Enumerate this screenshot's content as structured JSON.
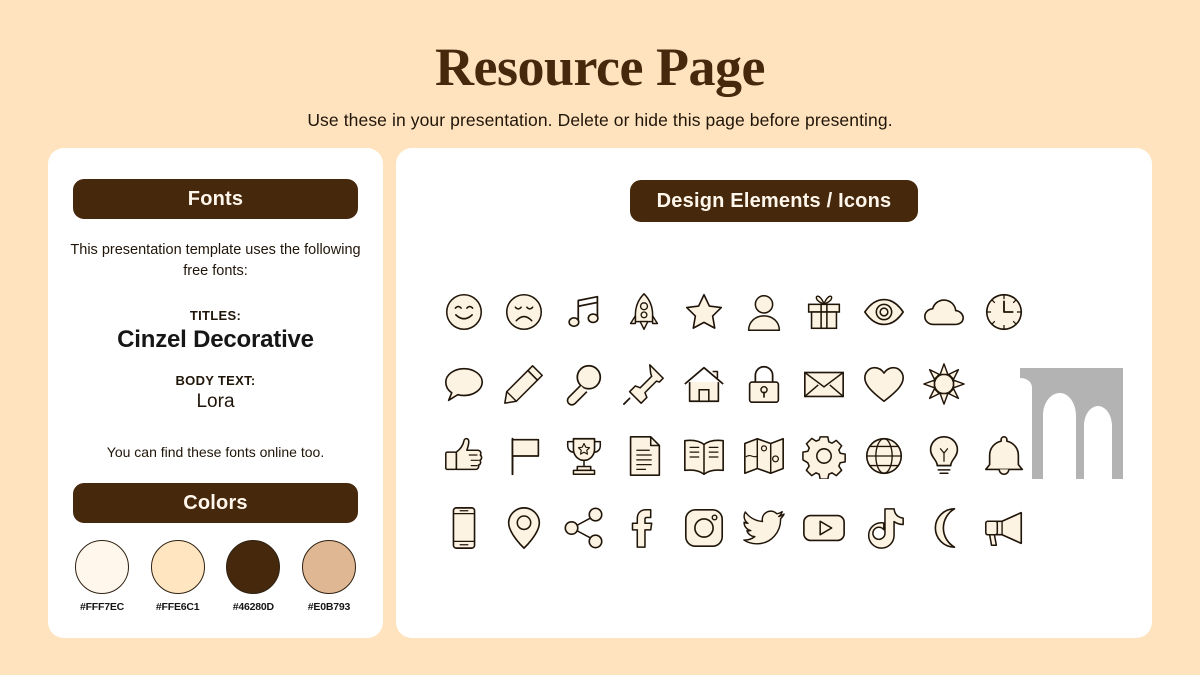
{
  "header": {
    "title": "Resource Page",
    "subtitle": "Use these in your presentation. Delete or hide this page before presenting."
  },
  "theme": {
    "background": "#FFE3BE",
    "panel": "#FFFFFF",
    "dark_brown": "#46280D",
    "cream": "#FFF7EC",
    "icon_fill": "#FDF3E3",
    "icon_stroke": "#201509",
    "arch_gray": "#B3B3B3"
  },
  "fonts_panel": {
    "heading": "Fonts",
    "intro": "This presentation template uses the following free fonts:",
    "titles_label": "TITLES:",
    "titles_font": "Cinzel Decorative",
    "body_label": "BODY TEXT:",
    "body_font": "Lora",
    "note": "You can find these fonts online too."
  },
  "colors_panel": {
    "heading": "Colors",
    "swatches": [
      {
        "hex": "#FFF7EC",
        "label": "#FFF7EC"
      },
      {
        "hex": "#FFE6C1",
        "label": "#FFE6C1"
      },
      {
        "hex": "#46280D",
        "label": "#46280D"
      },
      {
        "hex": "#E0B793",
        "label": "#E0B793"
      }
    ]
  },
  "design_panel": {
    "heading": "Design Elements / Icons",
    "icons": [
      {
        "name": "smiley-face-icon",
        "row": 1,
        "col": 1
      },
      {
        "name": "sad-face-icon",
        "row": 1,
        "col": 2
      },
      {
        "name": "music-note-icon",
        "row": 1,
        "col": 3
      },
      {
        "name": "rocket-icon",
        "row": 1,
        "col": 4
      },
      {
        "name": "star-icon",
        "row": 1,
        "col": 5
      },
      {
        "name": "user-icon",
        "row": 1,
        "col": 6
      },
      {
        "name": "gift-icon",
        "row": 1,
        "col": 7
      },
      {
        "name": "eye-icon",
        "row": 1,
        "col": 8
      },
      {
        "name": "cloud-icon",
        "row": 1,
        "col": 9
      },
      {
        "name": "clock-icon",
        "row": 1,
        "col": 10
      },
      {
        "name": "speech-bubble-icon",
        "row": 2,
        "col": 1
      },
      {
        "name": "pencil-icon",
        "row": 2,
        "col": 2
      },
      {
        "name": "magnifier-icon",
        "row": 2,
        "col": 3
      },
      {
        "name": "pushpin-icon",
        "row": 2,
        "col": 4
      },
      {
        "name": "house-icon",
        "row": 2,
        "col": 5
      },
      {
        "name": "lock-icon",
        "row": 2,
        "col": 6
      },
      {
        "name": "envelope-icon",
        "row": 2,
        "col": 7
      },
      {
        "name": "heart-icon",
        "row": 2,
        "col": 8
      },
      {
        "name": "sun-icon",
        "row": 2,
        "col": 9
      },
      {
        "name": "thumbs-up-icon",
        "row": 3,
        "col": 1
      },
      {
        "name": "flag-icon",
        "row": 3,
        "col": 2
      },
      {
        "name": "trophy-icon",
        "row": 3,
        "col": 3
      },
      {
        "name": "document-icon",
        "row": 3,
        "col": 4
      },
      {
        "name": "book-icon",
        "row": 3,
        "col": 5
      },
      {
        "name": "map-icon",
        "row": 3,
        "col": 6
      },
      {
        "name": "gear-icon",
        "row": 3,
        "col": 7
      },
      {
        "name": "globe-icon",
        "row": 3,
        "col": 8
      },
      {
        "name": "lightbulb-icon",
        "row": 3,
        "col": 9
      },
      {
        "name": "bell-icon",
        "row": 3,
        "col": 10
      },
      {
        "name": "phone-icon",
        "row": 4,
        "col": 1
      },
      {
        "name": "location-pin-icon",
        "row": 4,
        "col": 2
      },
      {
        "name": "share-icon",
        "row": 4,
        "col": 3
      },
      {
        "name": "facebook-icon",
        "row": 4,
        "col": 4
      },
      {
        "name": "instagram-icon",
        "row": 4,
        "col": 5
      },
      {
        "name": "twitter-icon",
        "row": 4,
        "col": 6
      },
      {
        "name": "youtube-icon",
        "row": 4,
        "col": 7
      },
      {
        "name": "tiktok-icon",
        "row": 4,
        "col": 8
      },
      {
        "name": "moon-icon",
        "row": 4,
        "col": 9
      },
      {
        "name": "megaphone-icon",
        "row": 4,
        "col": 10
      }
    ]
  },
  "decoration": {
    "arches_name": "gothic-arches-shape"
  }
}
